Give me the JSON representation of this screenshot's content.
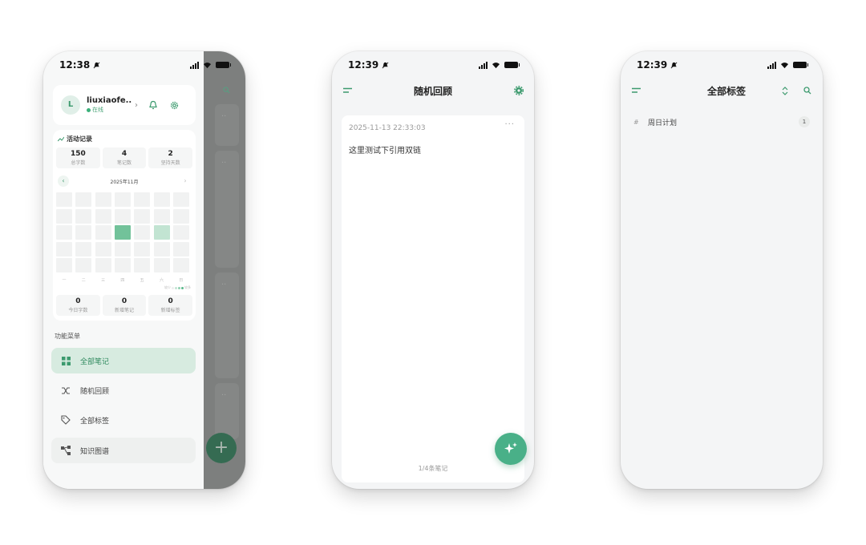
{
  "colors": {
    "accent": "#3c9a6e",
    "accent_light": "#d7ebe0",
    "fab": "#49b088",
    "overlay": "#7d7f7e"
  },
  "phone1": {
    "time": "12:38",
    "user": {
      "avatar_letter": "L",
      "name": "liuxiaofe...",
      "status": "在线"
    },
    "activity": {
      "title": "活动记录",
      "stats": [
        {
          "value": "150",
          "label": "总字数"
        },
        {
          "value": "4",
          "label": "笔记数"
        },
        {
          "value": "2",
          "label": "坚持天数"
        }
      ],
      "month": "2025年11月",
      "weekdays": [
        "一",
        "二",
        "三",
        "四",
        "五",
        "六",
        "日"
      ],
      "legend": [
        "较少",
        "较多"
      ],
      "bottom_stats": [
        {
          "value": "0",
          "label": "今日字数"
        },
        {
          "value": "0",
          "label": "新增笔记"
        },
        {
          "value": "0",
          "label": "新增标签"
        }
      ]
    },
    "menu_title": "功能菜单",
    "menu": [
      {
        "label": "全部笔记",
        "icon": "grid-icon"
      },
      {
        "label": "随机回顾",
        "icon": "shuffle-icon"
      },
      {
        "label": "全部标签",
        "icon": "tag-icon"
      },
      {
        "label": "知识图谱",
        "icon": "graph-icon"
      }
    ],
    "fab": "+"
  },
  "phone2": {
    "time": "12:39",
    "title": "随机回顾",
    "note": {
      "date": "2025-11-13 22:33:03",
      "more": "···",
      "content": "这里测试下引用双链"
    },
    "pagination": "1/4条笔记"
  },
  "phone3": {
    "time": "12:39",
    "title": "全部标签",
    "tags": [
      {
        "hash": "#",
        "name": "周日计划",
        "count": "1"
      }
    ]
  }
}
